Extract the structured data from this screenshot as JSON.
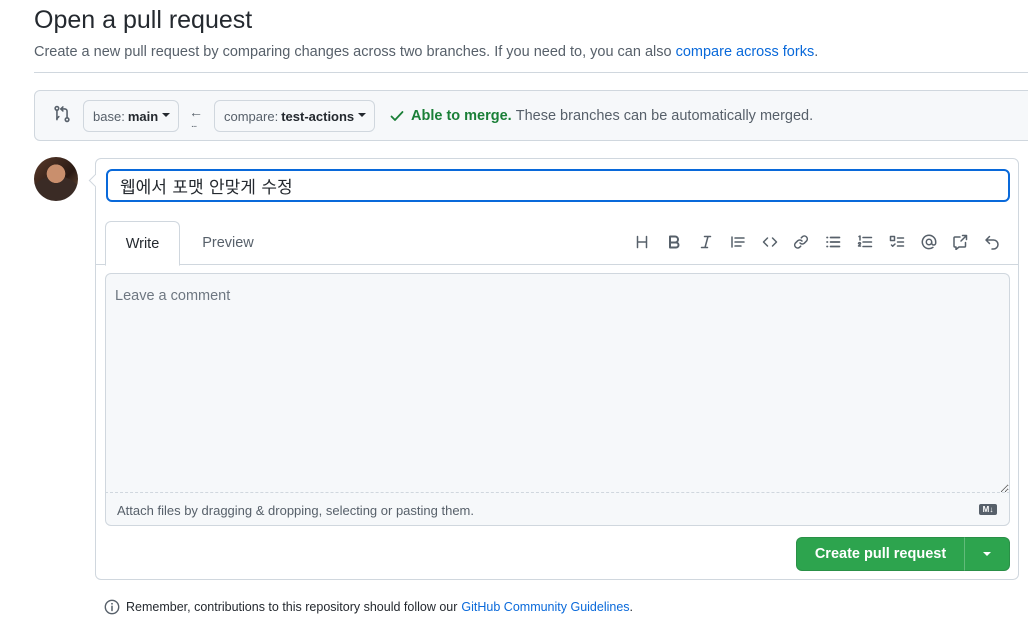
{
  "header": {
    "title": "Open a pull request",
    "subtitle": "Create a new pull request by comparing changes across two branches. If you need to, you can also",
    "forks_link": "compare across forks",
    "period": "."
  },
  "range": {
    "base_prefix": "base:",
    "base_branch": "main",
    "compare_prefix": "compare:",
    "compare_branch": "test-actions",
    "arrow_glyph": "←",
    "dots_glyph": "...",
    "merge_ok": "Able to merge.",
    "merge_text": "These branches can be automatically merged."
  },
  "form": {
    "title_value": "웹에서 포맷 안맞게 수정",
    "tabs": [
      "Write",
      "Preview"
    ],
    "toolbar_icons": [
      "heading-icon",
      "bold-icon",
      "italic-icon",
      "quote-icon",
      "code-icon",
      "link-icon",
      "unordered-list-icon",
      "ordered-list-icon",
      "task-list-icon",
      "mention-icon",
      "cross-reference-icon",
      "undo-icon"
    ],
    "comment_placeholder": "Leave a comment",
    "attach_text": "Attach files by dragging & dropping, selecting or pasting them.",
    "markdown_badge": "M↓",
    "submit_label": "Create pull request"
  },
  "footer": {
    "note": "Remember, contributions to this repository should follow our",
    "link": "GitHub Community Guidelines",
    "period": "."
  },
  "colors": {
    "accent_blue": "#0969da",
    "success_green": "#1a7f37",
    "button_green": "#2da44e",
    "border": "#d0d7de",
    "muted_text": "#57606a"
  }
}
